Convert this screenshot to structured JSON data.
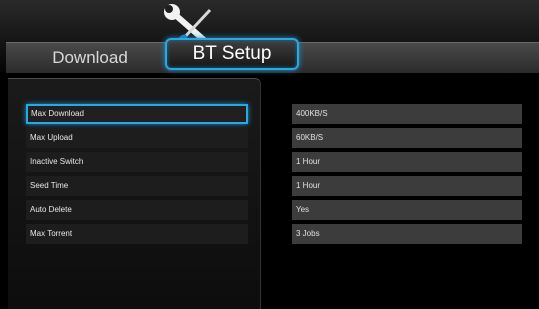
{
  "tabs": {
    "download_label": "Download",
    "bt_setup_label": "BT Setup"
  },
  "header": {
    "icon": "tools-icon"
  },
  "colors": {
    "accent": "#2aa8e0",
    "value_bg": "#3c3c3c"
  },
  "settings": [
    {
      "label": "Max Download",
      "value": "400KB/S",
      "selected": true
    },
    {
      "label": "Max Upload",
      "value": "60KB/S",
      "selected": false
    },
    {
      "label": "Inactive Switch",
      "value": "1 Hour",
      "selected": false
    },
    {
      "label": "Seed Time",
      "value": "1 Hour",
      "selected": false
    },
    {
      "label": "Auto Delete",
      "value": "Yes",
      "selected": false
    },
    {
      "label": "Max Torrent",
      "value": "3 Jobs",
      "selected": false
    }
  ]
}
